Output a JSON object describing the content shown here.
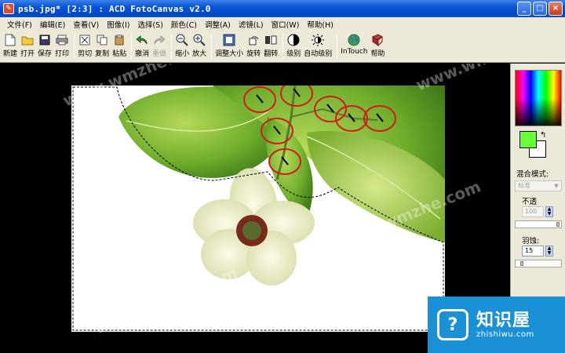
{
  "window": {
    "title": "psb.jpg* [2:3] : ACD FotoCanvas v2.0",
    "controls": [
      "_",
      "□",
      "×"
    ]
  },
  "menu": [
    "文件(F)",
    "编辑(E)",
    "查看(V)",
    "图像(I)",
    "选择(S)",
    "颜色(C)",
    "调整(A)",
    "滤镜(L)",
    "窗口(W)",
    "帮助(H)"
  ],
  "toolbar": {
    "new": "新建",
    "open": "打开",
    "save": "保存",
    "print": "打印",
    "cut": "剪切",
    "copy": "复制",
    "paste": "粘贴",
    "undo": "撤消",
    "redo": "重做",
    "zoom_out": "缩小",
    "zoom_in": "放大",
    "resize": "调整大小",
    "rotate": "旋转",
    "flip": "翻转",
    "levels": "级别",
    "auto_levels": "自动级别",
    "intouch": "InTouch",
    "help": "帮助"
  },
  "panel": {
    "foreground_color": "#66ff33",
    "background_color": "#ffffff",
    "blend_mode_label": "混合模式:",
    "blend_mode_value": "标准",
    "opacity_label": "不透",
    "opacity_value": "100",
    "feather_label": "羽蚀:",
    "feather_value": "15"
  },
  "watermarks": [
    "www.wmzhe.com",
    "www.wmzhe.com",
    "www.wmzhe.com",
    "www.wmzhe.com"
  ],
  "brand": {
    "name": "知识屋",
    "url": "zhishiwu.com"
  }
}
